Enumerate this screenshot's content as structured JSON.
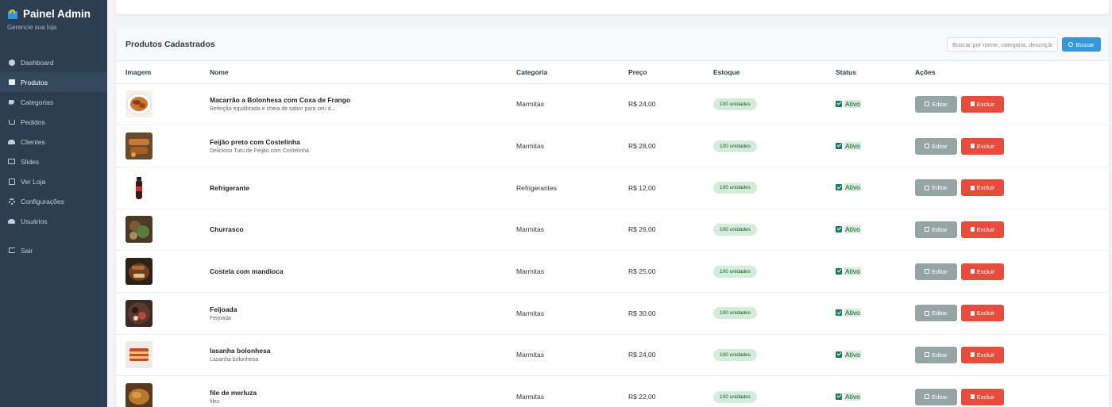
{
  "brand": {
    "title": "Painel Admin",
    "subtitle": "Gerencie sua loja"
  },
  "sidebar": {
    "items": [
      {
        "label": "Dashboard",
        "icon": "dashboard-icon"
      },
      {
        "label": "Produtos",
        "icon": "box-icon",
        "active": true
      },
      {
        "label": "Categorias",
        "icon": "tag-icon"
      },
      {
        "label": "Pedidos",
        "icon": "cart-icon"
      },
      {
        "label": "Clientes",
        "icon": "users-icon"
      },
      {
        "label": "Slides",
        "icon": "image-icon"
      },
      {
        "label": "Ver Loja",
        "icon": "external-link-icon"
      },
      {
        "label": "Configurações",
        "icon": "cog-icon"
      },
      {
        "label": "Usuários",
        "icon": "users-cog-icon"
      }
    ],
    "logout": {
      "label": "Sair",
      "icon": "sign-out-icon"
    }
  },
  "products_card": {
    "title": "Produtos Cadastrados",
    "search_placeholder": "Buscar por nome, categoria, descrição...",
    "search_button": "Buscar",
    "columns": [
      "Imagem",
      "Nome",
      "Categoria",
      "Preço",
      "Estoque",
      "Status",
      "Ações"
    ],
    "edit_label": "Editar",
    "delete_label": "Excluir",
    "rows": [
      {
        "name": "Macarrão a Bolonhesa com Coxa de Frango",
        "description": "Refeição equilibrada e cheia de sabor para seu d...",
        "category": "Marmitas",
        "price": "R$ 24,00",
        "stock": "100 unidades",
        "status": "Ativo",
        "thumb": "pasta"
      },
      {
        "name": "Feijão preto com Costelinha",
        "description": "Delicioso Tutu de Feijão com Costelinha",
        "category": "Marmitas",
        "price": "R$ 28,00",
        "stock": "100 unidades",
        "status": "Ativo",
        "thumb": "ribs"
      },
      {
        "name": "Refrigerante",
        "description": "",
        "category": "Refrigerantes",
        "price": "R$ 12,00",
        "stock": "100 unidades",
        "status": "Ativo",
        "thumb": "soda"
      },
      {
        "name": "Churrasco",
        "description": "",
        "category": "Marmitas",
        "price": "R$ 26,00",
        "stock": "100 unidades",
        "status": "Ativo",
        "thumb": "bbq"
      },
      {
        "name": "Costela com mandioca",
        "description": "",
        "category": "Marmitas",
        "price": "R$ 25,00",
        "stock": "100 unidades",
        "status": "Ativo",
        "thumb": "rib-cassava"
      },
      {
        "name": "Feijoada",
        "description": "Feijoada",
        "category": "Marmitas",
        "price": "R$ 30,00",
        "stock": "100 unidades",
        "status": "Ativo",
        "thumb": "feijoada"
      },
      {
        "name": "lasanha bolonhesa",
        "description": "Lasanha bolonhesa",
        "category": "Marmitas",
        "price": "R$ 24,00",
        "stock": "100 unidades",
        "status": "Ativo",
        "thumb": "lasagna"
      },
      {
        "name": "file de merluza",
        "description": "filez",
        "category": "Marmitas",
        "price": "R$ 22,00",
        "stock": "100 unidades",
        "status": "Ativo",
        "thumb": "fish"
      }
    ]
  },
  "colors": {
    "sidebar_bg": "#2c3e50",
    "primary": "#3498db",
    "edit": "#95a5a6",
    "delete": "#e74c3c",
    "badge_bg": "#d4edda"
  }
}
